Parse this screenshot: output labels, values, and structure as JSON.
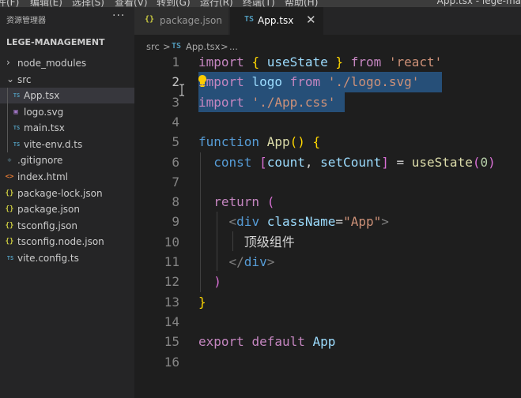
{
  "menubar": {
    "items": [
      "件(F)",
      "编辑(E)",
      "选择(S)",
      "查看(V)",
      "转到(G)",
      "运行(R)",
      "终端(T)",
      "帮助(H)"
    ],
    "window_title": "App.tsx - lege-ma"
  },
  "explorer": {
    "title": "资源管理器",
    "more": "···",
    "project": "LEGE-MANAGEMENT",
    "tree": [
      {
        "label": "node_modules",
        "type": "folder",
        "expanded": false
      },
      {
        "label": "src",
        "type": "folder",
        "expanded": true
      },
      {
        "label": "App.tsx",
        "type": "tsx",
        "selected": true
      },
      {
        "label": "logo.svg",
        "type": "svg"
      },
      {
        "label": "main.tsx",
        "type": "tsx"
      },
      {
        "label": "vite-env.d.ts",
        "type": "ts"
      },
      {
        "label": ".gitignore",
        "type": "git"
      },
      {
        "label": "index.html",
        "type": "html"
      },
      {
        "label": "package-lock.json",
        "type": "json"
      },
      {
        "label": "package.json",
        "type": "json"
      },
      {
        "label": "tsconfig.json",
        "type": "json"
      },
      {
        "label": "tsconfig.node.json",
        "type": "json"
      },
      {
        "label": "vite.config.ts",
        "type": "ts"
      }
    ]
  },
  "icons": {
    "tsx": "TS",
    "ts": "TS",
    "json": "{}",
    "svg": "▣",
    "git": "◆",
    "html": "<>",
    "folder_collapsed": "›",
    "folder_expanded": "⌄"
  },
  "colors": {
    "ts": "#519aba",
    "json": "#cbcb41",
    "svg": "#a074c4",
    "git": "#41535b",
    "html": "#e37933",
    "selection": "#264f78",
    "accent": "#007acc"
  },
  "tabs": [
    {
      "label": "package.json",
      "icon": "{}",
      "active": false
    },
    {
      "label": "App.tsx",
      "icon": "TS",
      "active": true,
      "close": "✕"
    }
  ],
  "breadcrumb": {
    "folder": "src",
    "sep1": ">",
    "ts_icon": "TS",
    "file": "App.tsx",
    "sep2": ">",
    "more": "..."
  },
  "editor": {
    "current_line": 2,
    "line_numbers": [
      "1",
      "2",
      "3",
      "4",
      "5",
      "6",
      "7",
      "8",
      "9",
      "10",
      "11",
      "12",
      "13",
      "14",
      "15",
      "16"
    ],
    "lines": [
      [
        [
          "kw",
          "import"
        ],
        [
          "pl",
          " "
        ],
        [
          "br",
          "{"
        ],
        [
          "pl",
          " "
        ],
        [
          "var",
          "useState"
        ],
        [
          "pl",
          " "
        ],
        [
          "br",
          "}"
        ],
        [
          "pl",
          " "
        ],
        [
          "kw",
          "from"
        ],
        [
          "pl",
          " "
        ],
        [
          "str",
          "'react'"
        ]
      ],
      [
        [
          "kw",
          "import"
        ],
        [
          "pl",
          " "
        ],
        [
          "var",
          "logo"
        ],
        [
          "pl",
          " "
        ],
        [
          "kw",
          "from"
        ],
        [
          "pl",
          " "
        ],
        [
          "str",
          "'./logo.svg'"
        ]
      ],
      [
        [
          "kw",
          "import"
        ],
        [
          "pl",
          " "
        ],
        [
          "str",
          "'./App.css'"
        ]
      ],
      [],
      [
        [
          "kw2",
          "function"
        ],
        [
          "pl",
          " "
        ],
        [
          "fn",
          "App"
        ],
        [
          "br",
          "()"
        ],
        [
          "pl",
          " "
        ],
        [
          "br",
          "{"
        ]
      ],
      [
        [
          "pl",
          "  "
        ],
        [
          "kw2",
          "const"
        ],
        [
          "pl",
          " "
        ],
        [
          "br2",
          "["
        ],
        [
          "var",
          "count"
        ],
        [
          "pl",
          ", "
        ],
        [
          "var",
          "setCount"
        ],
        [
          "br2",
          "]"
        ],
        [
          "pl",
          " = "
        ],
        [
          "fn",
          "useState"
        ],
        [
          "br2",
          "("
        ],
        [
          "num",
          "0"
        ],
        [
          "br2",
          ")"
        ]
      ],
      [],
      [
        [
          "pl",
          "  "
        ],
        [
          "kw",
          "return"
        ],
        [
          "pl",
          " "
        ],
        [
          "br2",
          "("
        ]
      ],
      [
        [
          "pl",
          "    "
        ],
        [
          "gray",
          "<"
        ],
        [
          "tag",
          "div"
        ],
        [
          "pl",
          " "
        ],
        [
          "var",
          "className"
        ],
        [
          "pl",
          "="
        ],
        [
          "str",
          "\"App\""
        ],
        [
          "gray",
          ">"
        ]
      ],
      [
        [
          "pl",
          "      顶级组件"
        ]
      ],
      [
        [
          "pl",
          "    "
        ],
        [
          "gray",
          "</"
        ],
        [
          "tag",
          "div"
        ],
        [
          "gray",
          ">"
        ]
      ],
      [
        [
          "pl",
          "  "
        ],
        [
          "br2",
          ")"
        ]
      ],
      [
        [
          "br",
          "}"
        ]
      ],
      [],
      [
        [
          "kw",
          "export"
        ],
        [
          "pl",
          " "
        ],
        [
          "kw",
          "default"
        ],
        [
          "pl",
          " "
        ],
        [
          "var",
          "App"
        ]
      ],
      []
    ]
  }
}
